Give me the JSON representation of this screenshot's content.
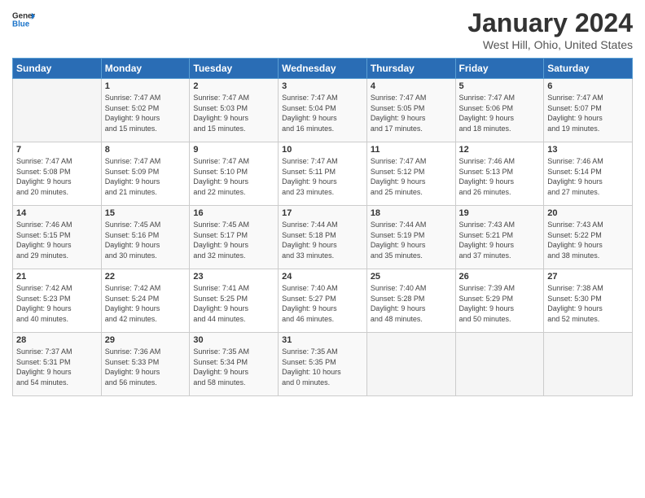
{
  "header": {
    "logo_line1": "General",
    "logo_line2": "Blue",
    "month": "January 2024",
    "location": "West Hill, Ohio, United States"
  },
  "days_of_week": [
    "Sunday",
    "Monday",
    "Tuesday",
    "Wednesday",
    "Thursday",
    "Friday",
    "Saturday"
  ],
  "weeks": [
    [
      {
        "num": "",
        "info": ""
      },
      {
        "num": "1",
        "info": "Sunrise: 7:47 AM\nSunset: 5:02 PM\nDaylight: 9 hours\nand 15 minutes."
      },
      {
        "num": "2",
        "info": "Sunrise: 7:47 AM\nSunset: 5:03 PM\nDaylight: 9 hours\nand 15 minutes."
      },
      {
        "num": "3",
        "info": "Sunrise: 7:47 AM\nSunset: 5:04 PM\nDaylight: 9 hours\nand 16 minutes."
      },
      {
        "num": "4",
        "info": "Sunrise: 7:47 AM\nSunset: 5:05 PM\nDaylight: 9 hours\nand 17 minutes."
      },
      {
        "num": "5",
        "info": "Sunrise: 7:47 AM\nSunset: 5:06 PM\nDaylight: 9 hours\nand 18 minutes."
      },
      {
        "num": "6",
        "info": "Sunrise: 7:47 AM\nSunset: 5:07 PM\nDaylight: 9 hours\nand 19 minutes."
      }
    ],
    [
      {
        "num": "7",
        "info": "Sunrise: 7:47 AM\nSunset: 5:08 PM\nDaylight: 9 hours\nand 20 minutes."
      },
      {
        "num": "8",
        "info": "Sunrise: 7:47 AM\nSunset: 5:09 PM\nDaylight: 9 hours\nand 21 minutes."
      },
      {
        "num": "9",
        "info": "Sunrise: 7:47 AM\nSunset: 5:10 PM\nDaylight: 9 hours\nand 22 minutes."
      },
      {
        "num": "10",
        "info": "Sunrise: 7:47 AM\nSunset: 5:11 PM\nDaylight: 9 hours\nand 23 minutes."
      },
      {
        "num": "11",
        "info": "Sunrise: 7:47 AM\nSunset: 5:12 PM\nDaylight: 9 hours\nand 25 minutes."
      },
      {
        "num": "12",
        "info": "Sunrise: 7:46 AM\nSunset: 5:13 PM\nDaylight: 9 hours\nand 26 minutes."
      },
      {
        "num": "13",
        "info": "Sunrise: 7:46 AM\nSunset: 5:14 PM\nDaylight: 9 hours\nand 27 minutes."
      }
    ],
    [
      {
        "num": "14",
        "info": "Sunrise: 7:46 AM\nSunset: 5:15 PM\nDaylight: 9 hours\nand 29 minutes."
      },
      {
        "num": "15",
        "info": "Sunrise: 7:45 AM\nSunset: 5:16 PM\nDaylight: 9 hours\nand 30 minutes."
      },
      {
        "num": "16",
        "info": "Sunrise: 7:45 AM\nSunset: 5:17 PM\nDaylight: 9 hours\nand 32 minutes."
      },
      {
        "num": "17",
        "info": "Sunrise: 7:44 AM\nSunset: 5:18 PM\nDaylight: 9 hours\nand 33 minutes."
      },
      {
        "num": "18",
        "info": "Sunrise: 7:44 AM\nSunset: 5:19 PM\nDaylight: 9 hours\nand 35 minutes."
      },
      {
        "num": "19",
        "info": "Sunrise: 7:43 AM\nSunset: 5:21 PM\nDaylight: 9 hours\nand 37 minutes."
      },
      {
        "num": "20",
        "info": "Sunrise: 7:43 AM\nSunset: 5:22 PM\nDaylight: 9 hours\nand 38 minutes."
      }
    ],
    [
      {
        "num": "21",
        "info": "Sunrise: 7:42 AM\nSunset: 5:23 PM\nDaylight: 9 hours\nand 40 minutes."
      },
      {
        "num": "22",
        "info": "Sunrise: 7:42 AM\nSunset: 5:24 PM\nDaylight: 9 hours\nand 42 minutes."
      },
      {
        "num": "23",
        "info": "Sunrise: 7:41 AM\nSunset: 5:25 PM\nDaylight: 9 hours\nand 44 minutes."
      },
      {
        "num": "24",
        "info": "Sunrise: 7:40 AM\nSunset: 5:27 PM\nDaylight: 9 hours\nand 46 minutes."
      },
      {
        "num": "25",
        "info": "Sunrise: 7:40 AM\nSunset: 5:28 PM\nDaylight: 9 hours\nand 48 minutes."
      },
      {
        "num": "26",
        "info": "Sunrise: 7:39 AM\nSunset: 5:29 PM\nDaylight: 9 hours\nand 50 minutes."
      },
      {
        "num": "27",
        "info": "Sunrise: 7:38 AM\nSunset: 5:30 PM\nDaylight: 9 hours\nand 52 minutes."
      }
    ],
    [
      {
        "num": "28",
        "info": "Sunrise: 7:37 AM\nSunset: 5:31 PM\nDaylight: 9 hours\nand 54 minutes."
      },
      {
        "num": "29",
        "info": "Sunrise: 7:36 AM\nSunset: 5:33 PM\nDaylight: 9 hours\nand 56 minutes."
      },
      {
        "num": "30",
        "info": "Sunrise: 7:35 AM\nSunset: 5:34 PM\nDaylight: 9 hours\nand 58 minutes."
      },
      {
        "num": "31",
        "info": "Sunrise: 7:35 AM\nSunset: 5:35 PM\nDaylight: 10 hours\nand 0 minutes."
      },
      {
        "num": "",
        "info": ""
      },
      {
        "num": "",
        "info": ""
      },
      {
        "num": "",
        "info": ""
      }
    ]
  ]
}
